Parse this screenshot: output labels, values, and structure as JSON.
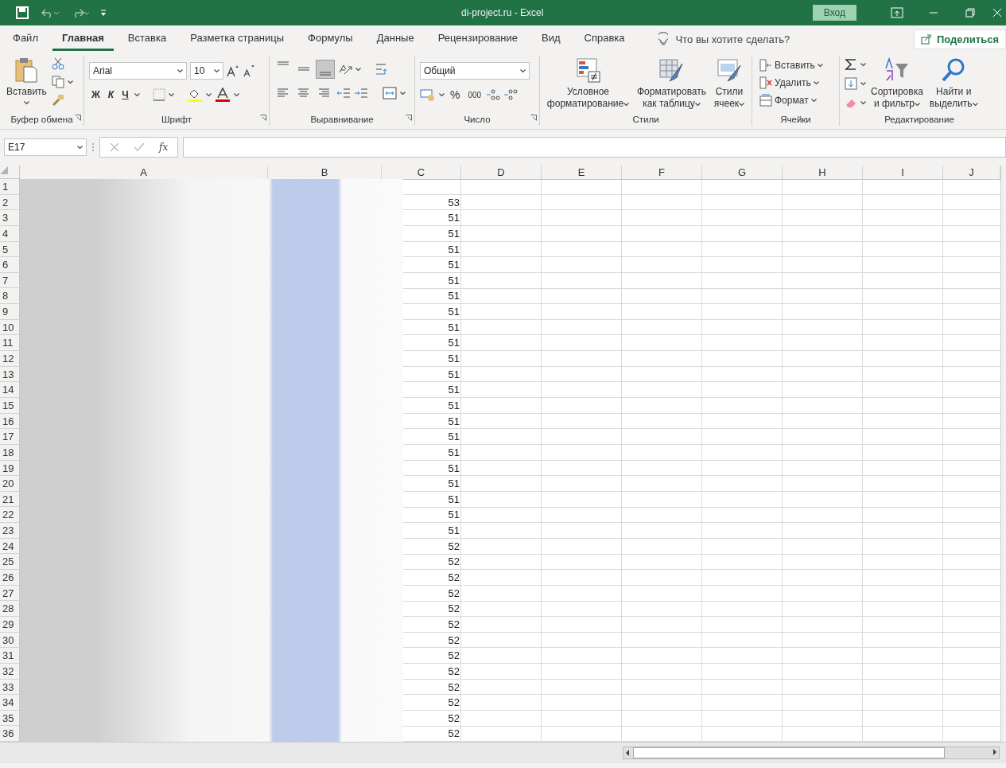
{
  "title_bar": {
    "title": "di-project.ru  -  Excel",
    "sign_in": "Вход"
  },
  "tabs": [
    {
      "label": "Файл",
      "selected": false
    },
    {
      "label": "Главная",
      "selected": true
    },
    {
      "label": "Вставка",
      "selected": false
    },
    {
      "label": "Разметка страницы",
      "selected": false
    },
    {
      "label": "Формулы",
      "selected": false
    },
    {
      "label": "Данные",
      "selected": false
    },
    {
      "label": "Рецензирование",
      "selected": false
    },
    {
      "label": "Вид",
      "selected": false
    },
    {
      "label": "Справка",
      "selected": false
    }
  ],
  "tell_me": "Что вы хотите сделать?",
  "share": "Поделиться",
  "ribbon": {
    "clipboard": {
      "label": "Буфер обмена",
      "paste": "Вставить"
    },
    "font": {
      "label": "Шрифт",
      "font_name": "Arial",
      "font_size": "10",
      "bold": "Ж",
      "italic": "К",
      "underline": "Ч"
    },
    "alignment": {
      "label": "Выравнивание",
      "vertical": [
        {
          "kind": "top",
          "selected": false
        },
        {
          "kind": "middle",
          "selected": false
        },
        {
          "kind": "bottom",
          "selected": true
        }
      ],
      "horizontal": [
        {
          "kind": "left",
          "selected": false
        },
        {
          "kind": "center",
          "selected": false
        },
        {
          "kind": "right",
          "selected": false
        }
      ]
    },
    "number": {
      "label": "Число",
      "format": "Общий",
      "percent": "%",
      "thousands": "000"
    },
    "styles": {
      "label": "Стили",
      "buttons": [
        {
          "kind": "conditional",
          "label": "Условное\nформатирование"
        },
        {
          "kind": "table",
          "label": "Форматировать\nкак таблицу"
        },
        {
          "kind": "cellstyles",
          "label": "Стили\nячеек"
        }
      ]
    },
    "cells": {
      "label": "Ячейки",
      "buttons": [
        {
          "kind": "insert",
          "label": "Вставить"
        },
        {
          "kind": "delete",
          "label": "Удалить"
        },
        {
          "kind": "format",
          "label": "Формат"
        }
      ]
    },
    "editing": {
      "label": "Редактирование",
      "buttons": [
        {
          "kind": "sort",
          "label": "Сортировка\nи фильтр"
        },
        {
          "kind": "find",
          "label": "Найти и\nвыделить"
        }
      ]
    }
  },
  "formula_bar": {
    "name_box": "E17",
    "function_label": "fx"
  },
  "sheet": {
    "columns": [
      "A",
      "B",
      "C",
      "D",
      "E",
      "F",
      "G",
      "H",
      "I",
      "J"
    ],
    "rows": [
      {
        "row": "1"
      },
      {
        "row": "2",
        "c": "53"
      },
      {
        "row": "3",
        "c": "51"
      },
      {
        "row": "4",
        "c": "51"
      },
      {
        "row": "5",
        "c": "51"
      },
      {
        "row": "6",
        "c": "51"
      },
      {
        "row": "7",
        "c": "51"
      },
      {
        "row": "8",
        "c": "51"
      },
      {
        "row": "9",
        "c": "51"
      },
      {
        "row": "10",
        "c": "51"
      },
      {
        "row": "11",
        "c": "51"
      },
      {
        "row": "12",
        "c": "51"
      },
      {
        "row": "13",
        "c": "51"
      },
      {
        "row": "14",
        "c": "51"
      },
      {
        "row": "15",
        "c": "51"
      },
      {
        "row": "16",
        "c": "51"
      },
      {
        "row": "17",
        "c": "51"
      },
      {
        "row": "18",
        "c": "51"
      },
      {
        "row": "19",
        "c": "51"
      },
      {
        "row": "20",
        "c": "51"
      },
      {
        "row": "21",
        "c": "51"
      },
      {
        "row": "22",
        "c": "51"
      },
      {
        "row": "23",
        "c": "51"
      },
      {
        "row": "24",
        "c": "52"
      },
      {
        "row": "25",
        "c": "52"
      },
      {
        "row": "26",
        "c": "52"
      },
      {
        "row": "27",
        "c": "52"
      },
      {
        "row": "28",
        "c": "52"
      },
      {
        "row": "29",
        "c": "52"
      },
      {
        "row": "30",
        "c": "52"
      },
      {
        "row": "31",
        "c": "52"
      },
      {
        "row": "32",
        "c": "52"
      },
      {
        "row": "33",
        "c": "52"
      },
      {
        "row": "34",
        "c": "52"
      },
      {
        "row": "35",
        "c": "52"
      },
      {
        "row": "36",
        "c": "52"
      }
    ]
  }
}
